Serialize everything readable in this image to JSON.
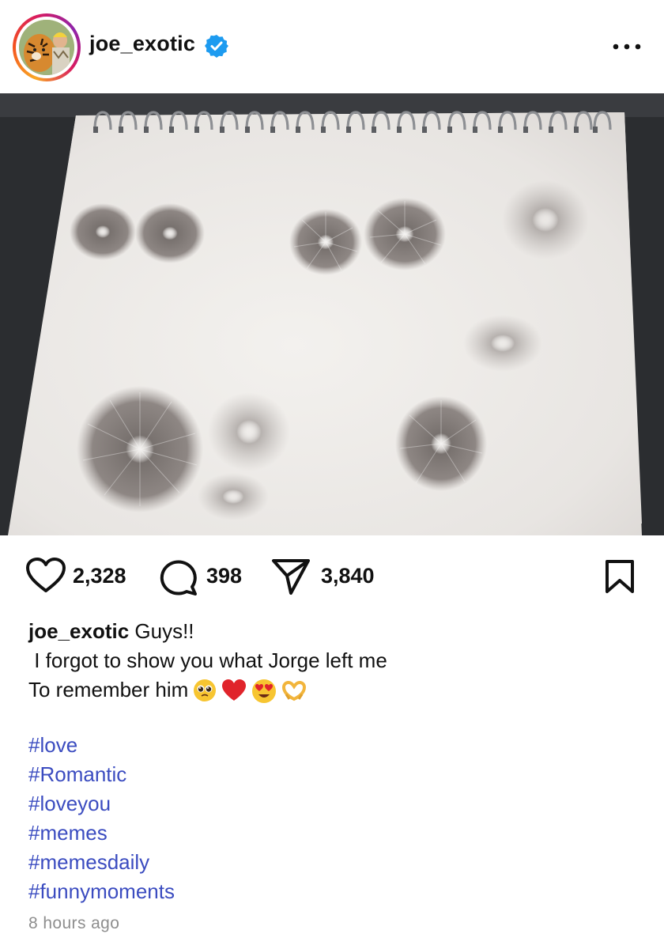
{
  "header": {
    "username": "joe_exotic",
    "verified": true,
    "more_icon": "more-horizontal-icon"
  },
  "post": {
    "image_description_icon": "photo"
  },
  "actions": {
    "likes": "2,328",
    "comments": "398",
    "shares": "3,840",
    "icons": [
      "heart-icon",
      "comment-icon",
      "send-icon",
      "bookmark-icon"
    ]
  },
  "caption": {
    "username": "joe_exotic",
    "line1": " Guys!!",
    "line2": " I forgot to show you what Jorge left me",
    "line3": "To remember him",
    "emojis": [
      "pleading-face",
      "red-heart",
      "heart-eyes",
      "heart-hands"
    ]
  },
  "hashtags": [
    "#love",
    "#Romantic",
    "#loveyou",
    "#memes",
    "#memesdaily",
    "#funnymoments"
  ],
  "timestamp": "8 hours ago",
  "colors": {
    "hashtag": "#3b4cc0",
    "verified": "#1d9bf0",
    "timestamp": "#8e8e8e"
  }
}
